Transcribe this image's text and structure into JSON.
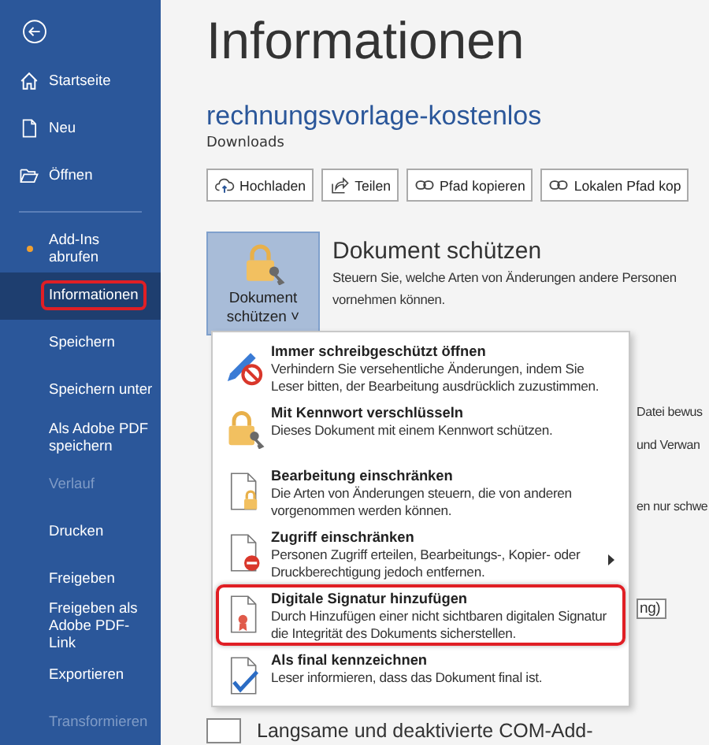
{
  "sidebar": {
    "items": [
      {
        "label": "Startseite",
        "kind": "home",
        "selected": false,
        "disabled": false,
        "outlined": false
      },
      {
        "label": "Neu",
        "kind": "page",
        "selected": false,
        "disabled": false,
        "outlined": false
      },
      {
        "label": "Öffnen",
        "kind": "folder",
        "selected": false,
        "disabled": false,
        "outlined": false
      },
      {
        "label": "Add-Ins abrufen",
        "kind": "dot",
        "selected": false,
        "disabled": false,
        "outlined": false,
        "divider_before": true
      },
      {
        "label": "Informationen",
        "kind": "plain",
        "selected": true,
        "disabled": false,
        "outlined": true
      },
      {
        "label": "Speichern",
        "kind": "plain",
        "selected": false,
        "disabled": false,
        "outlined": false
      },
      {
        "label": "Speichern unter",
        "kind": "plain",
        "selected": false,
        "disabled": false,
        "outlined": false
      },
      {
        "label": "Als Adobe PDF speichern",
        "kind": "plain",
        "selected": false,
        "disabled": false,
        "outlined": false
      },
      {
        "label": "Verlauf",
        "kind": "plain",
        "selected": false,
        "disabled": true,
        "outlined": false
      },
      {
        "label": "Drucken",
        "kind": "plain",
        "selected": false,
        "disabled": false,
        "outlined": false
      },
      {
        "label": "Freigeben",
        "kind": "plain",
        "selected": false,
        "disabled": false,
        "outlined": false
      },
      {
        "label": "Freigeben als Adobe PDF-Link",
        "kind": "plain",
        "selected": false,
        "disabled": false,
        "outlined": false
      },
      {
        "label": "Exportieren",
        "kind": "plain",
        "selected": false,
        "disabled": false,
        "outlined": false
      },
      {
        "label": "Transformieren",
        "kind": "plain",
        "selected": false,
        "disabled": true,
        "outlined": false
      }
    ]
  },
  "page": {
    "title": "Informationen",
    "file_name": "rechnungsvorlage-kostenlos",
    "location": "Downloads",
    "actions": [
      {
        "label": "Hochladen",
        "kind": "cloud"
      },
      {
        "label": "Teilen",
        "kind": "share"
      },
      {
        "label": "Pfad kopieren",
        "kind": "link"
      },
      {
        "label": "Lokalen Pfad kop",
        "kind": "link"
      }
    ],
    "protect": {
      "button_line1": "Dokument",
      "button_line2": "schützen",
      "caret": "˅",
      "heading": "Dokument schützen",
      "description_lines": [
        "Steuern Sie, welche Arten von Änderungen andere Personen",
        "vornehmen können."
      ]
    },
    "background_fragments": [
      "Datei bewus",
      "und Verwan",
      "en nur schwe"
    ],
    "background_field": "ng)",
    "bottom_heading": "Langsame und deaktivierte COM-Add-"
  },
  "protect_menu": {
    "items": [
      {
        "title": "Immer schreibgeschützt öffnen",
        "description": "Verhindern Sie versehentliche Änderungen, indem Sie Leser bitten, der Bearbeitung ausdrücklich zuzustimmen.",
        "kind": "pen",
        "submenu": false,
        "outlined": false
      },
      {
        "title": "Mit Kennwort verschlüsseln",
        "description": "Dieses Dokument mit einem Kennwort schützen.",
        "kind": "lock",
        "submenu": false,
        "outlined": false
      },
      {
        "title": "Bearbeitung einschränken",
        "description": "Die Arten von Änderungen steuern, die von anderen vorgenommen werden können.",
        "kind": "doc-lock",
        "submenu": false,
        "outlined": false
      },
      {
        "title": "Zugriff einschränken",
        "description": "Personen Zugriff erteilen, Bearbeitungs-, Kopier- oder Druckberechtigung jedoch entfernen.",
        "kind": "doc-block",
        "submenu": true,
        "outlined": false
      },
      {
        "title": "Digitale Signatur hinzufügen",
        "description": "Durch Hinzufügen einer nicht sichtbaren digitalen Signatur die Integrität des Dokuments sicherstellen.",
        "kind": "doc-ribbon",
        "submenu": false,
        "outlined": true
      },
      {
        "title": "Als final kennzeichnen",
        "description": "Leser informieren, dass das Dokument final ist.",
        "kind": "doc-check",
        "submenu": false,
        "outlined": false
      }
    ]
  }
}
